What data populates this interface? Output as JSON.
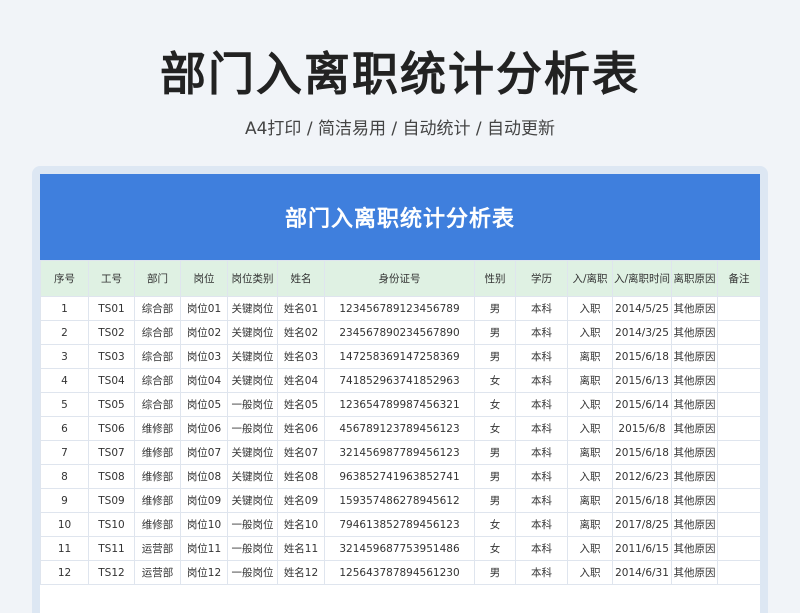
{
  "header": {
    "title": "部门入离职统计分析表",
    "subtitle": "A4打印 / 简洁易用 / 自动统计 / 自动更新"
  },
  "sheet": {
    "banner_title": "部门入离职统计分析表",
    "columns": [
      "序号",
      "工号",
      "部门",
      "岗位",
      "岗位类别",
      "姓名",
      "身份证号",
      "性别",
      "学历",
      "入/离职",
      "入/离职时间",
      "离职原因",
      "备注"
    ],
    "rows": [
      [
        "1",
        "TS01",
        "综合部",
        "岗位01",
        "关键岗位",
        "姓名01",
        "123456789123456789",
        "男",
        "本科",
        "入职",
        "2014/5/25",
        "其他原因",
        ""
      ],
      [
        "2",
        "TS02",
        "综合部",
        "岗位02",
        "关键岗位",
        "姓名02",
        "234567890234567890",
        "男",
        "本科",
        "入职",
        "2014/3/25",
        "其他原因",
        ""
      ],
      [
        "3",
        "TS03",
        "综合部",
        "岗位03",
        "关键岗位",
        "姓名03",
        "147258369147258369",
        "男",
        "本科",
        "离职",
        "2015/6/18",
        "其他原因",
        ""
      ],
      [
        "4",
        "TS04",
        "综合部",
        "岗位04",
        "关键岗位",
        "姓名04",
        "741852963741852963",
        "女",
        "本科",
        "离职",
        "2015/6/13",
        "其他原因",
        ""
      ],
      [
        "5",
        "TS05",
        "综合部",
        "岗位05",
        "一般岗位",
        "姓名05",
        "123654789987456321",
        "女",
        "本科",
        "入职",
        "2015/6/14",
        "其他原因",
        ""
      ],
      [
        "6",
        "TS06",
        "维修部",
        "岗位06",
        "一般岗位",
        "姓名06",
        "456789123789456123",
        "女",
        "本科",
        "入职",
        "2015/6/8",
        "其他原因",
        ""
      ],
      [
        "7",
        "TS07",
        "维修部",
        "岗位07",
        "关键岗位",
        "姓名07",
        "321456987789456123",
        "男",
        "本科",
        "离职",
        "2015/6/18",
        "其他原因",
        ""
      ],
      [
        "8",
        "TS08",
        "维修部",
        "岗位08",
        "关键岗位",
        "姓名08",
        "963852741963852741",
        "男",
        "本科",
        "入职",
        "2012/6/23",
        "其他原因",
        ""
      ],
      [
        "9",
        "TS09",
        "维修部",
        "岗位09",
        "关键岗位",
        "姓名09",
        "159357486278945612",
        "男",
        "本科",
        "离职",
        "2015/6/18",
        "其他原因",
        ""
      ],
      [
        "10",
        "TS10",
        "维修部",
        "岗位10",
        "一般岗位",
        "姓名10",
        "794613852789456123",
        "女",
        "本科",
        "离职",
        "2017/8/25",
        "其他原因",
        ""
      ],
      [
        "11",
        "TS11",
        "运营部",
        "岗位11",
        "一般岗位",
        "姓名11",
        "321459687753951486",
        "女",
        "本科",
        "入职",
        "2011/6/15",
        "其他原因",
        ""
      ],
      [
        "12",
        "TS12",
        "运营部",
        "岗位12",
        "一般岗位",
        "姓名12",
        "125643787894561230",
        "男",
        "本科",
        "入职",
        "2014/6/31",
        "其他原因",
        ""
      ]
    ]
  }
}
